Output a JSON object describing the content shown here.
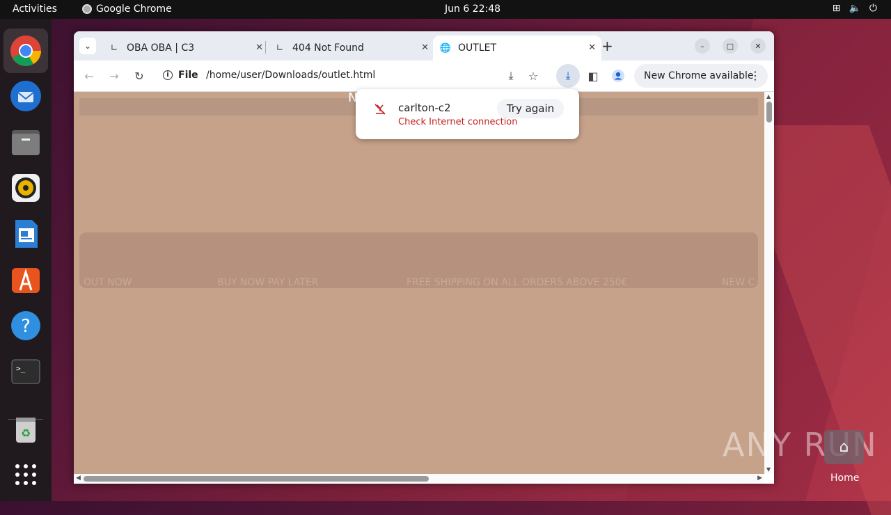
{
  "topbar": {
    "activities": "Activities",
    "app_name": "Google Chrome",
    "clock": "Jun 6  22:48"
  },
  "dock": {
    "items": [
      "chrome-icon",
      "thunderbird-icon",
      "files-icon",
      "rhythmbox-icon",
      "writer-icon",
      "app-center-icon",
      "help-icon",
      "terminal-icon",
      "trash-icon",
      "app-grid-icon"
    ]
  },
  "tabs": [
    {
      "title": "OBA OBA | C3",
      "active": false
    },
    {
      "title": "404 Not Found",
      "active": false
    },
    {
      "title": "OUTLET",
      "active": true
    }
  ],
  "toolbar": {
    "scheme": "File",
    "url": "/home/user/Downloads/outlet.html",
    "update_label": "New Chrome available"
  },
  "download": {
    "filename": "carlton-c2",
    "status": "Check Internet connection",
    "retry_label": "Try again"
  },
  "page": {
    "header_letter": "N",
    "marquee": [
      "OUT NOW",
      "BUY NOW PAY LATER",
      "FREE SHIPPING ON ALL ORDERS ABOVE 250€",
      "NEW C"
    ]
  },
  "desktop": {
    "watermark": "ANY RUN",
    "home_label": "Home"
  },
  "colors": {
    "page_bg": "#c6a28a",
    "error": "#c5221f",
    "accent": "#1a5fd0"
  }
}
